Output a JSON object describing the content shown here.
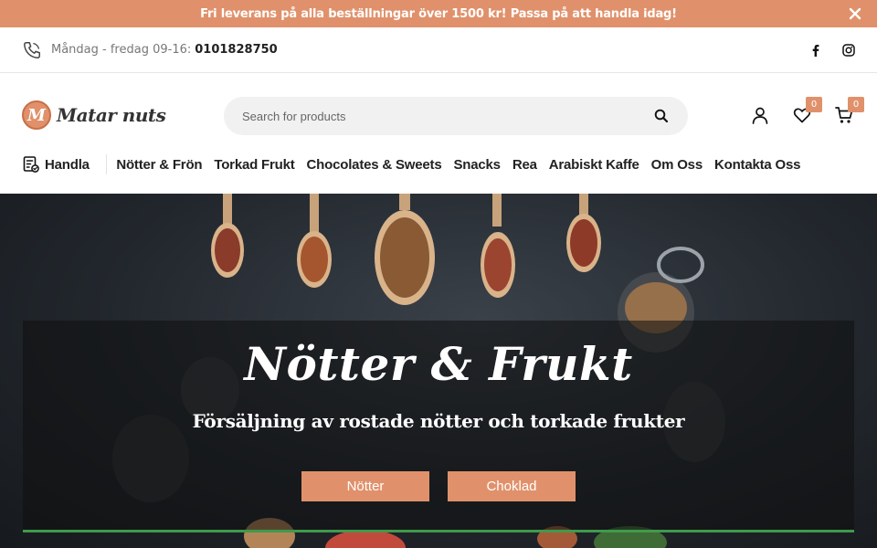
{
  "promo": {
    "text": "Fri leverans på alla beställningar över 1500 kr! Passa på att handla idag!"
  },
  "infobar": {
    "hours": "Måndag - fredag 09-16:",
    "phone": "0101828750"
  },
  "header": {
    "logo_text": "Matar nuts",
    "logo_letter": "M",
    "search_placeholder": "Search for products",
    "wishlist_count": "0",
    "cart_count": "0"
  },
  "nav": {
    "shop_label": "Handla",
    "items": [
      "Nötter & Frön",
      "Torkad Frukt",
      "Chocolates & Sweets",
      "Snacks",
      "Rea",
      "Arabiskt Kaffe",
      "Om Oss",
      "Kontakta Oss"
    ]
  },
  "hero": {
    "title": "Nötter & Frukt",
    "subtitle": "Försäljning av rostade nötter och torkade frukter",
    "button_1": "Nötter",
    "button_2": "Choklad"
  },
  "colors": {
    "accent": "#e0916b",
    "hero_dark": "#22272d",
    "divider_green": "#3f9a4a"
  },
  "icons": [
    "close-icon",
    "phone-icon",
    "facebook-icon",
    "instagram-icon",
    "search-icon",
    "user-icon",
    "heart-icon",
    "cart-icon",
    "shop-list-icon"
  ]
}
